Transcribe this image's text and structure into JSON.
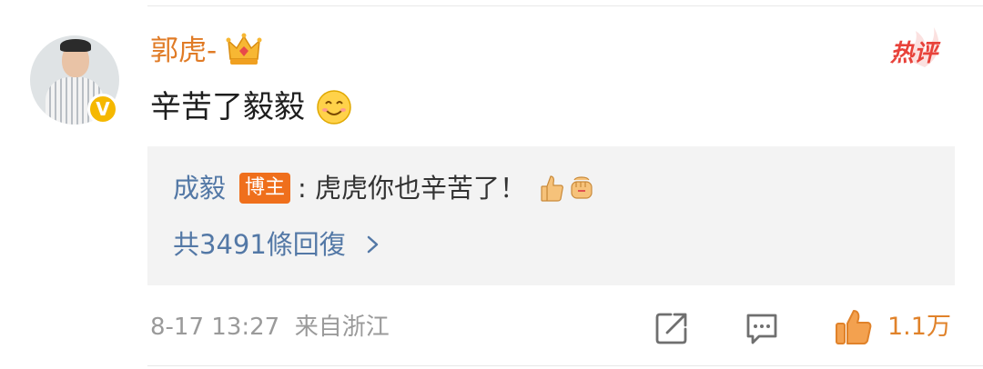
{
  "comment": {
    "username": "郭虎-",
    "text": "辛苦了毅毅",
    "hot_label": "热评",
    "verified_badge": "V"
  },
  "reply": {
    "author": "成毅",
    "author_tag": "博主",
    "text": ": 虎虎你也辛苦了！",
    "count_label": "共3491條回復"
  },
  "footer": {
    "timestamp": "8-17 13:27",
    "source": "来自浙江",
    "like_count": "1.1万"
  },
  "colors": {
    "username": "#e07b26",
    "reply_link": "#5378a6",
    "hot_label": "#e8423a",
    "like_accent": "#e0822a",
    "blogger_tag_bg": "#ef6f1c",
    "verified_badge": "#f5b800"
  },
  "icons": {
    "crown": "crown-icon",
    "hot": "hot-comment-icon",
    "share": "share-icon",
    "reply": "comment-icon",
    "like": "thumbs-up-icon"
  }
}
